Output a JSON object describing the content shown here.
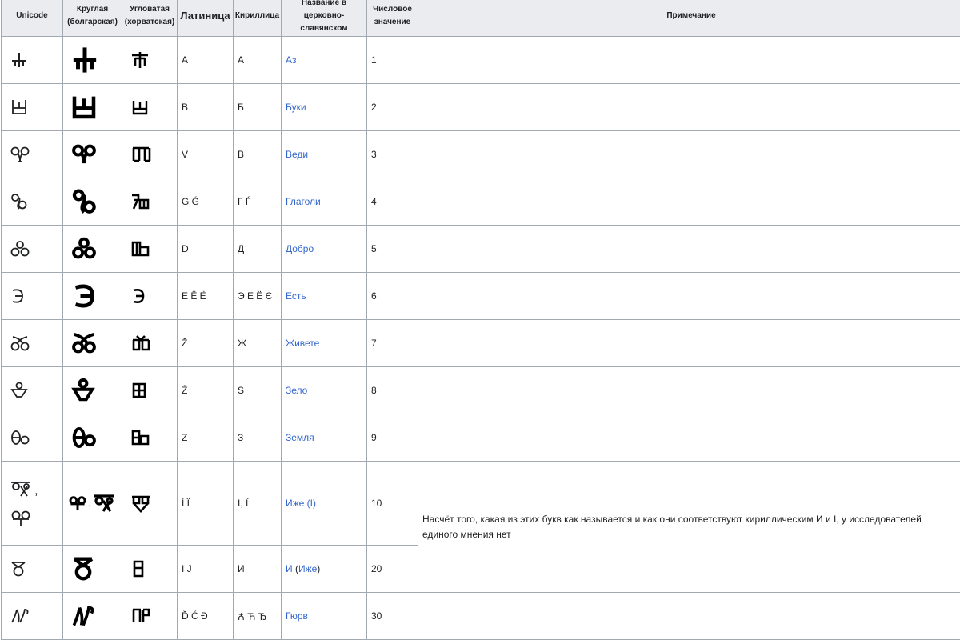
{
  "table": {
    "headers": {
      "unicode": "Unicode",
      "round": "Круглая (болгарская)",
      "angular": "Угловатая (хорватская)",
      "latin": "Латиница",
      "cyrillic": "Кириллица",
      "name": "Название в церковно-славянском",
      "value": "Числовое значение",
      "note": "Примечание"
    },
    "rows": [
      {
        "glyph_icon": "glagolitic-az-icon",
        "latin": "A",
        "cyrillic": "А",
        "name": "Аз",
        "value": "1"
      },
      {
        "glyph_icon": "glagolitic-buki-icon",
        "latin": "B",
        "cyrillic": "Б",
        "name": "Буки",
        "value": "2"
      },
      {
        "glyph_icon": "glagolitic-vedi-icon",
        "latin": "V",
        "cyrillic": "В",
        "name": "Веди",
        "value": "3"
      },
      {
        "glyph_icon": "glagolitic-glagoli-icon",
        "latin": "G Ǵ",
        "cyrillic": "Г Ѓ",
        "name": "Глаголи",
        "value": "4"
      },
      {
        "glyph_icon": "glagolitic-dobro-icon",
        "latin": "D",
        "cyrillic": "Д",
        "name": "Добро",
        "value": "5"
      },
      {
        "glyph_icon": "glagolitic-est-icon",
        "latin": "E Ê Ë",
        "cyrillic": "Э Е Ё Є",
        "name": "Есть",
        "value": "6"
      },
      {
        "glyph_icon": "glagolitic-zhivete-icon",
        "latin": "Ž",
        "cyrillic": "Ж",
        "name": "Живете",
        "value": "7"
      },
      {
        "glyph_icon": "glagolitic-zelo-icon",
        "latin": "Ẑ",
        "cyrillic": "Ѕ",
        "name": "Зело",
        "value": "8"
      },
      {
        "glyph_icon": "glagolitic-zemlja-icon",
        "latin": "Z",
        "cyrillic": "З",
        "name": "Земля",
        "value": "9"
      },
      {
        "glyph_icon": "glagolitic-izhe-icon",
        "unicode_sep": ",",
        "round_sep": ",",
        "latin": "Ì Ï",
        "cyrillic": "І, Ї",
        "name": "Иже (І)",
        "value": "10"
      },
      {
        "glyph_icon": "glagolitic-i-icon",
        "latin": "I J",
        "cyrillic": "И",
        "name": "И",
        "name_paren_open": " (",
        "name_paren_link": "Иже",
        "name_paren_close": ")",
        "value": "20"
      },
      {
        "glyph_icon": "glagolitic-gjerv-icon",
        "latin": "Ď Ć Đ",
        "cyrillic": "Ꙉ Ћ Ђ",
        "name": "Гюрв",
        "value": "30"
      }
    ],
    "note_izhe": "Насчёт того, какая из этих букв как называется и как они соответствуют кириллическим И и І, у исследователей единого мнения нет"
  }
}
